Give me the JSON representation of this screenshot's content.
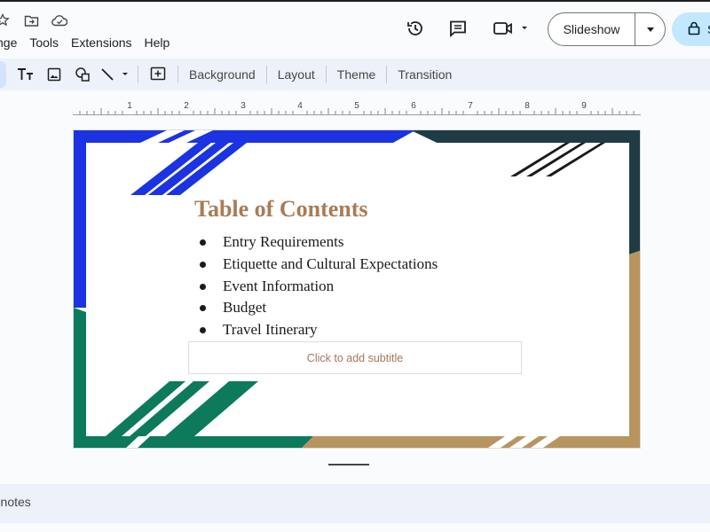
{
  "menu": {
    "items": [
      "nge",
      "Tools",
      "Extensions",
      "Help"
    ]
  },
  "doc_icons": [
    "star-icon",
    "move-to-folder-icon",
    "cloud-saved-icon"
  ],
  "header_actions": {
    "history_icon": "version-history-icon",
    "comments_icon": "comments-icon",
    "meet_icon": "video-call-icon",
    "slideshow_label": "Slideshow",
    "share_label": "S"
  },
  "toolbar": {
    "icons": [
      "text-box-icon",
      "image-icon",
      "shape-icon",
      "line-icon",
      "add-comment-icon"
    ],
    "background_label": "Background",
    "layout_label": "Layout",
    "theme_label": "Theme",
    "transition_label": "Transition"
  },
  "ruler": {
    "labels": [
      "1",
      "2",
      "3",
      "4",
      "5",
      "6",
      "7",
      "8",
      "9"
    ]
  },
  "slide": {
    "title": "Table of Contents",
    "bullets": [
      "Entry Requirements",
      "Etiquette and Cultural Expectations",
      "Event Information",
      "Budget",
      "Travel Itinerary"
    ],
    "subtitle_placeholder": "Click to add subtitle",
    "colors": {
      "blue": "#1b33e0",
      "dark": "#1f3b44",
      "green": "#0d7a5c",
      "tan": "#b8955f",
      "title": "#a97b56"
    }
  },
  "notes": {
    "label": "r notes"
  }
}
